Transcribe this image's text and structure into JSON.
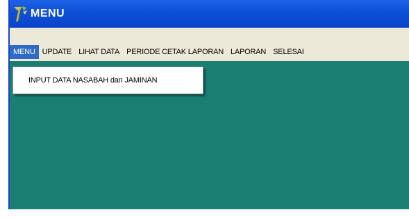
{
  "window": {
    "title": "MENU",
    "colors": {
      "titlebar": "#0d4fd8",
      "client": "#1a7f72",
      "menubar": "#ece9d8",
      "highlight": "#316ac5"
    },
    "icon": "app-logo-icon"
  },
  "menubar": {
    "items": [
      {
        "label": "MENU"
      },
      {
        "label": "UPDATE"
      },
      {
        "label": "LIHAT DATA"
      },
      {
        "label": "PERIODE CETAK LAPORAN"
      },
      {
        "label": "LAPORAN"
      },
      {
        "label": "SELESAI"
      }
    ]
  },
  "dropdown": {
    "items": [
      {
        "label": "INPUT DATA NASABAH dan JAMINAN"
      }
    ]
  }
}
